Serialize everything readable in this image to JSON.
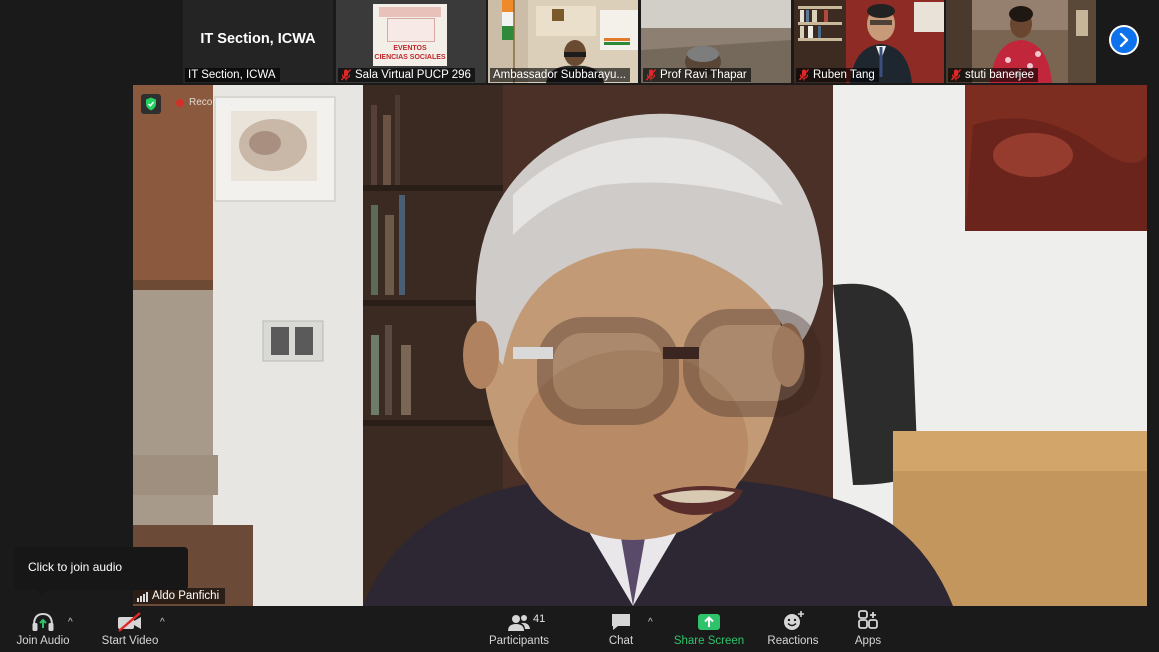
{
  "gallery": {
    "tiles": [
      {
        "name": "IT Section, ICWA",
        "big_name": "IT Section, ICWA",
        "muted": false
      },
      {
        "name": "Sala Virtual PUCP 296",
        "muted": true,
        "poster_line1": "EVENTOS",
        "poster_line2": "CIENCIAS SOCIALES"
      },
      {
        "name": "Ambassador Subbarayu...",
        "muted": true
      },
      {
        "name": "Prof Ravi Thapar",
        "muted": true
      },
      {
        "name": "Ruben Tang",
        "muted": true
      },
      {
        "name": "stuti banerjee",
        "muted": true
      }
    ],
    "next_page_icon": "chevron-right-icon"
  },
  "main_video": {
    "speaker_name": "Aldo Panfichi",
    "recording_label": "Recording",
    "encryption_icon": "shield-check-icon"
  },
  "tooltip": {
    "text": "Click to join audio"
  },
  "toolbar": {
    "join_audio": "Join Audio",
    "start_video": "Start Video",
    "participants": "Participants",
    "participants_count": "41",
    "chat": "Chat",
    "share_screen": "Share Screen",
    "reactions": "Reactions",
    "apps": "Apps"
  },
  "colors": {
    "accent_blue": "#0e72ed",
    "share_green": "#2ec36a",
    "muted_red": "#e02828",
    "background": "#1a1a1a"
  }
}
